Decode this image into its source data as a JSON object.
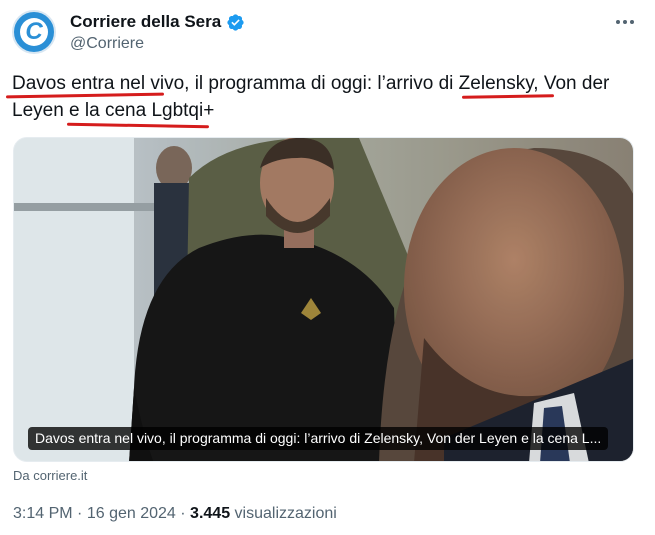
{
  "account": {
    "display_name": "Corriere della Sera",
    "handle": "@Corriere",
    "avatar_letter": "C",
    "verified": true,
    "brand_color": "#2a8fd6"
  },
  "tweet": {
    "text_line1": "Davos  entra nel vivo, il programma di oggi: l’arrivo di  Zelensky, Von der",
    "text_line2": "Leyen e la cena Lgbtqi+",
    "annotation_color": "#d51c1c"
  },
  "media": {
    "caption": "Davos entra nel vivo, il programma di oggi: l’arrivo di Zelensky, Von der Leyen e la cena L...",
    "source": "Da corriere.it"
  },
  "meta": {
    "time": "3:14 PM",
    "date": "16 gen 2024",
    "separator": "·",
    "views_count": "3.445",
    "views_label": "visualizzazioni"
  },
  "icons": {
    "verified": "verified-badge-icon",
    "more": "more-options-icon"
  }
}
